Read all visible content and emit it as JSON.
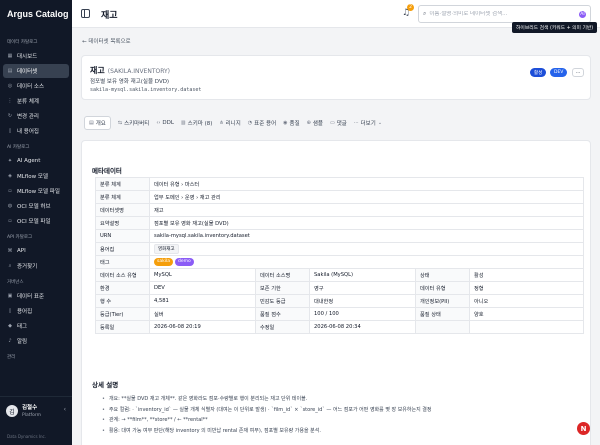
{
  "app": {
    "title": "Argus Catalog"
  },
  "sidebar": {
    "sections": [
      {
        "title": "데이터 카탈로그",
        "items": [
          {
            "label": "대시보드",
            "icon": "grid-icon"
          },
          {
            "label": "데이터셋",
            "icon": "dataset-icon",
            "active": true
          },
          {
            "label": "데이터 소스",
            "icon": "database-icon"
          },
          {
            "label": "분류 체계",
            "icon": "tree-icon"
          },
          {
            "label": "변경 관리",
            "icon": "history-icon"
          },
          {
            "label": "내 용어집",
            "icon": "book-icon"
          }
        ]
      },
      {
        "title": "AI 카탈로그",
        "items": [
          {
            "label": "AI Agent",
            "icon": "bot-icon"
          },
          {
            "label": "MLflow 모델",
            "icon": "cube-icon"
          },
          {
            "label": "MLflow 모델 파일",
            "icon": "file-icon"
          },
          {
            "label": "OCI 모델 허브",
            "icon": "hub-icon"
          },
          {
            "label": "OCI 모델 파일",
            "icon": "file-icon"
          }
        ]
      },
      {
        "title": "API 카탈로그",
        "items": [
          {
            "label": "API",
            "icon": "api-icon"
          },
          {
            "label": "증거찾기",
            "icon": "search-icon"
          }
        ]
      },
      {
        "title": "거버넌스",
        "items": [
          {
            "label": "데이터 표준",
            "icon": "standard-icon"
          },
          {
            "label": "용어집",
            "icon": "book-icon"
          },
          {
            "label": "태그",
            "icon": "tag-icon"
          },
          {
            "label": "알림",
            "icon": "bell-icon"
          }
        ]
      },
      {
        "title": "관리",
        "items": []
      }
    ],
    "user": {
      "initial": "김",
      "name": "김철수",
      "role": "Platform"
    },
    "footer": "Data Dynamics Inc."
  },
  "header": {
    "title": "재고",
    "notif_count": "2",
    "search_placeholder": "이름·설명·의미로 데이터셋 검색...",
    "mode_icon": "AI",
    "tooltip": "하이브리드 검색 (키워드 + 의미 기반)"
  },
  "main": {
    "back_label": "데이터셋 목록으로",
    "title": "재고",
    "subtitle": "(SAKILA.INVENTORY)",
    "description": "점포별 보유 영화 재고(실물 DVD)",
    "path": "sakila-mysql.sakila.inventory.dataset",
    "status_badge": "활성",
    "env_badge": "DEV",
    "more_label": "···",
    "tabs": [
      {
        "label": "개요",
        "icon": "doc-icon",
        "active": true
      },
      {
        "label": "스키마버티",
        "icon": "schema-icon"
      },
      {
        "label": "DDL",
        "icon": "code-icon"
      },
      {
        "label": "스키마 (8)",
        "icon": "columns-icon"
      },
      {
        "label": "리니지",
        "icon": "lineage-icon"
      },
      {
        "label": "표준 용어",
        "icon": "standard-icon"
      },
      {
        "label": "품질",
        "icon": "check-icon"
      },
      {
        "label": "샘플",
        "icon": "globe-icon"
      },
      {
        "label": "댓글",
        "icon": "comment-icon"
      },
      {
        "label": "더보기",
        "icon": "more-icon"
      }
    ],
    "metadata_title": "메타데이터",
    "meta": {
      "k_category": "분류 체계",
      "v_category": "데이터 유형 › 마스터",
      "k_domain": "분류 체계",
      "v_domain": "업무 도메인 › 운영 › 재고 관리",
      "k_name": "데이터셋명",
      "v_name": "재고",
      "k_desc": "요약설명",
      "v_desc": "점포별 보유 영화 재고(실물 DVD)",
      "k_urn": "URN",
      "v_urn": "sakila-mysql.sakila.inventory.dataset",
      "k_term": "용어집",
      "v_term": "영화재고",
      "k_tag": "태그",
      "tags": [
        "sakila",
        "demo"
      ],
      "k_srctype": "데이터 소스 유형",
      "v_srctype": "MySQL",
      "k_src": "데이터 소스명",
      "v_src": "Sakila (MySQL)",
      "k_state": "상태",
      "v_state": "활성",
      "k_env": "환경",
      "v_env": "DEV",
      "k_retention": "보존 기한",
      "v_retention": "영구",
      "k_dtype": "데이터 유형",
      "v_dtype": "정형",
      "k_rows": "행 수",
      "v_rows": "4,581",
      "k_sens": "민감도 등급",
      "v_sens": "대내한정",
      "k_pii": "개인정보(PII)",
      "v_pii": "아니오",
      "k_tier": "등급(Tier)",
      "v_tier": "실버",
      "k_qscore": "품질 점수",
      "v_qscore": "100 / 100",
      "k_qstate": "품질 상태",
      "v_qstate": "양호",
      "k_reg": "등록일",
      "v_reg": "2026-06-08 20:19",
      "k_mod": "수정일",
      "v_mod": "2026-06-08 20:34"
    },
    "detail_title": "상세 설명",
    "bullets": [
      "개요: **실물 DVD 재고 개체**. 같은 영화라도 점포·수량별로 행이 분리되는 재고 단위 테이블.",
      "주요 컬럼: · `inventory_id` — 실물 개체 식별자 (대여는 이 단위로 발생) · `film_id` × `store_id` — 어느 점포가 어떤 영화를 몇 장 보유하는지 결정",
      "관계: → **film**, **store** / ← **rental**",
      "활용: 대여 가능 여부 판단(해당 inventory 의 미반납 rental 존재 여부), 점포별 보유량 가용을 분석."
    ]
  },
  "fab": {
    "label": "N"
  }
}
